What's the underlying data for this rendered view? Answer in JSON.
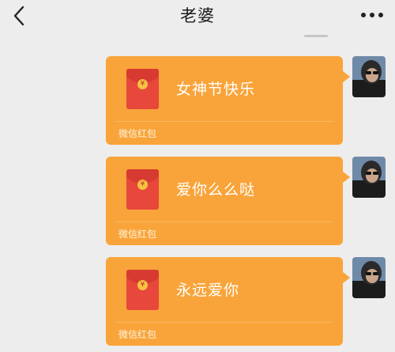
{
  "header": {
    "title": "老婆",
    "back_icon": "chevron-left-icon",
    "more_icon": "more-dots-icon"
  },
  "colors": {
    "background": "#ededed",
    "bubble": "#f9a43a",
    "envelope": "#e8473c",
    "seal": "#f5c242"
  },
  "messages": [
    {
      "text": "女神节快乐",
      "label": "微信红包"
    },
    {
      "text": "爱你么么哒",
      "label": "微信红包"
    },
    {
      "text": "永远爱你",
      "label": "微信红包"
    }
  ]
}
